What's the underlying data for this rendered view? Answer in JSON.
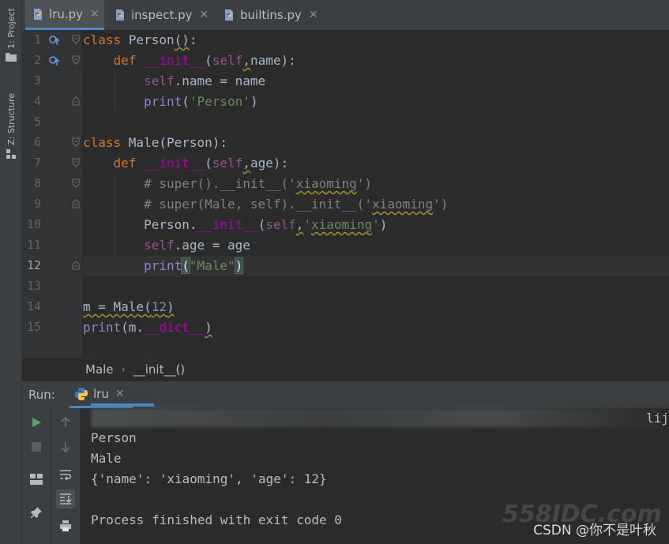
{
  "side_panel": {
    "project_label": "1: Project",
    "structure_label": "Z: Structure"
  },
  "tabs": [
    {
      "label": "lru.py",
      "active": true
    },
    {
      "label": "inspect.py",
      "active": false
    },
    {
      "label": "builtins.py",
      "active": false
    }
  ],
  "editor": {
    "current_line": 12,
    "line_numbers": [
      "1",
      "2",
      "3",
      "4",
      "5",
      "6",
      "7",
      "8",
      "9",
      "10",
      "11",
      "12",
      "13",
      "14",
      "15"
    ]
  },
  "breadcrumbs": {
    "class_name": "Male",
    "method_name": "__init__()"
  },
  "run_panel": {
    "label": "Run:",
    "tab_label": "lru",
    "cmd_tail": "lij",
    "output": [
      "Person",
      "Male",
      "{'name': 'xiaoming', 'age': 12}",
      "",
      "Process finished with exit code 0"
    ]
  },
  "watermarks": {
    "site": "558IDC.com",
    "author": "CSDN @你不是叶秋"
  },
  "colors": {
    "accent": "#4a88c7",
    "keyword": "#cc7832",
    "self": "#94558d",
    "dunder": "#b200b2",
    "string": "#6a8759",
    "number": "#6897bb"
  }
}
